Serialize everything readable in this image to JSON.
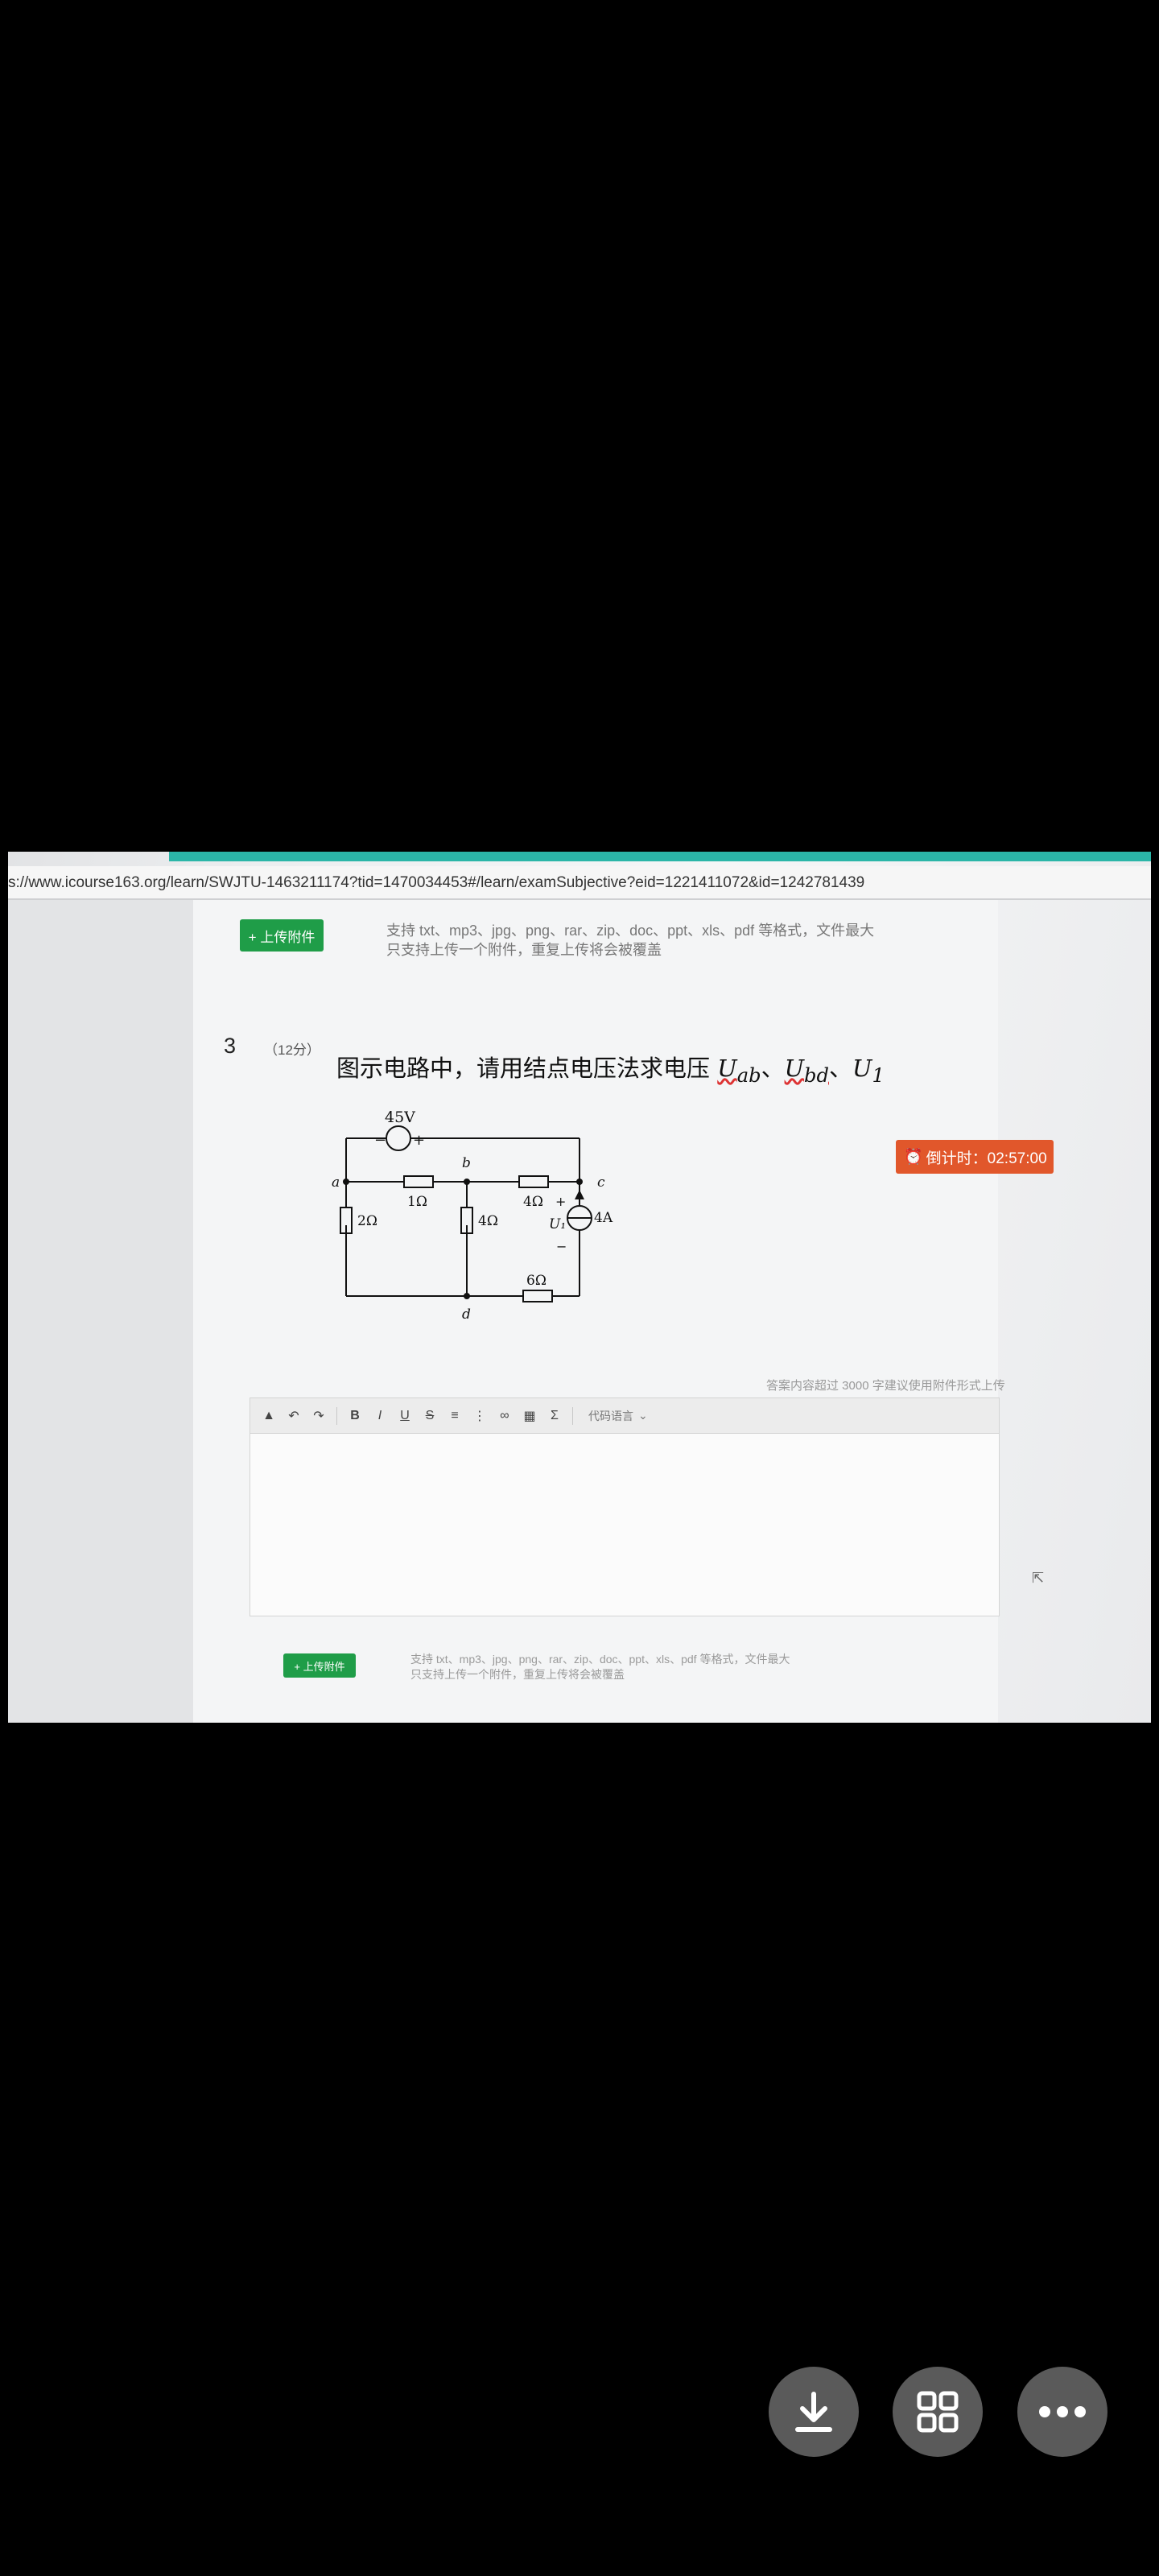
{
  "browser": {
    "url": "s://www.icourse163.org/learn/SWJTU-1463211174?tid=1470034453#/learn/examSubjective?eid=1221411072&id=1242781439"
  },
  "upload_top": {
    "button": "+ 上传附件",
    "hint_line1": "支持 txt、mp3、jpg、png、rar、zip、doc、ppt、xls、pdf 等格式，文件最大",
    "hint_line2": "只支持上传一个附件，重复上传将会被覆盖"
  },
  "question": {
    "number": "3",
    "score": "（12分）",
    "text": "图示电路中，请用结点电压法求电压",
    "var1": "U",
    "var1_sub": "ab",
    "sep1": "、",
    "var2": "U",
    "var2_sub": "bd",
    "sep2": "、",
    "var3": "U",
    "var3_sub": "1"
  },
  "circuit": {
    "source_voltage": "45V",
    "minus": "−",
    "plus": "+",
    "node_a": "a",
    "node_b": "b",
    "node_c": "c",
    "node_d": "d",
    "r_ab": "1Ω",
    "r_bc": "4Ω",
    "r_ad": "2Ω",
    "r_bd": "4Ω",
    "r_dc": "6Ω",
    "current_source": "4A",
    "u1_label": "U₁",
    "u1_plus": "+",
    "u1_minus": "−"
  },
  "countdown": {
    "label": "倒计时：02:57:00",
    "icon": "alarm-clock-icon"
  },
  "editor": {
    "limit_text": "答案内容超过 3000 字建议使用附件形式上传",
    "code_language": "代码语言",
    "toolbar_icons": [
      "format-paint-icon",
      "undo-icon",
      "redo-icon",
      "bold-icon",
      "italic-icon",
      "underline-icon",
      "strikethrough-icon",
      "ordered-list-icon",
      "unordered-list-icon",
      "link-icon",
      "image-icon",
      "formula-icon"
    ]
  },
  "upload_bottom": {
    "button": "+ 上传附件",
    "hint_line1": "支持 txt、mp3、jpg、png、rar、zip、doc、ppt、xls、pdf 等格式，文件最大",
    "hint_line2": "只支持上传一个附件，重复上传将会被覆盖"
  },
  "viewer_buttons": [
    "download-icon",
    "grid-icon",
    "more-icon"
  ],
  "colors": {
    "accent_green": "#1f9d48",
    "countdown_orange": "#e1572b",
    "teal": "#2bb6a8"
  }
}
